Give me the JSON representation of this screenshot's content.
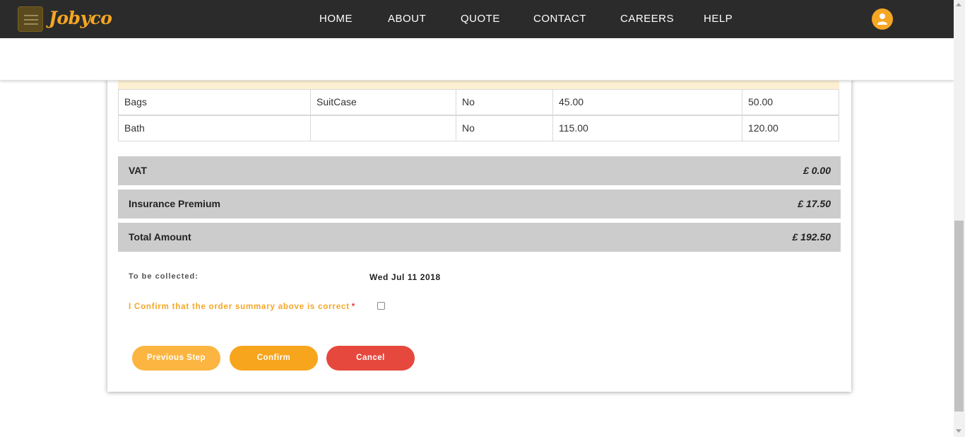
{
  "brand": {
    "logo_text": "Jobyco"
  },
  "nav": {
    "items": [
      "HOME",
      "ABOUT",
      "QUOTE",
      "CONTACT",
      "CAREERS",
      "HELP"
    ]
  },
  "table": {
    "rows": [
      [
        "Bags",
        "SuitCase",
        "No",
        "45.00",
        "50.00"
      ],
      [
        "Bath",
        "",
        "No",
        "115.00",
        "120.00"
      ]
    ]
  },
  "summary": [
    {
      "label": "VAT",
      "value": "£ 0.00"
    },
    {
      "label": "Insurance Premium",
      "value": "£ 17.50"
    },
    {
      "label": "Total Amount",
      "value": "£ 192.50"
    }
  ],
  "collection": {
    "label": "To be collected:",
    "date": "Wed Jul 11 2018"
  },
  "confirm": {
    "text": "I Confirm that the order summary above is correct",
    "required_marker": "*"
  },
  "buttons": {
    "previous": "Previous Step",
    "confirm": "Confirm",
    "cancel": "Cancel"
  },
  "colors": {
    "accent": "#f5a623",
    "cancel": "#e6483d",
    "nav_bg": "#2b2b2b",
    "summary_bg": "#cccccc"
  }
}
